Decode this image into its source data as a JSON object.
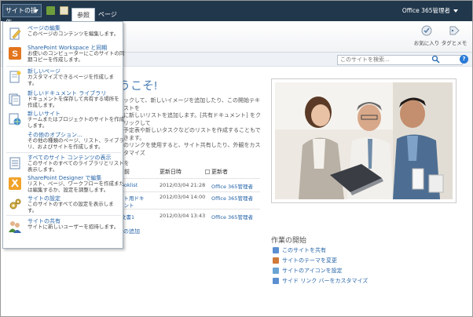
{
  "topbar": {
    "site_actions_label": "サイトの操作",
    "tabs": [
      "参照",
      "ページ"
    ],
    "user_label": "Office 365管理者"
  },
  "ribbon": {
    "favorite_label": "お気に入り",
    "tags_label": "タグとメモ"
  },
  "search": {
    "placeholder": "このサイトを検索..."
  },
  "menu": {
    "items": [
      {
        "title": "ページの編集",
        "desc": [
          "このページのコンテンツを編集します。"
        ],
        "icon": "edit-page-icon"
      },
      {
        "title": "SharePoint Workspace と同期",
        "desc": [
          "お使いのコンピューターにこのサイトの同",
          "期コピーを作成します。"
        ],
        "icon": "workspace-sync-icon"
      },
      {
        "title": "新しいページ",
        "desc": [
          "カスタマイズできるページを作成しま",
          "す。"
        ],
        "icon": "new-page-icon"
      },
      {
        "title": "新しいドキュメント ライブラリ",
        "desc": [
          "ドキュメントを保存して共有する場所を",
          "作成します。"
        ],
        "icon": "new-doc-library-icon"
      },
      {
        "title": "新しいサイト",
        "desc": [
          "チームまたはプロジェクトのサイトを作成",
          "します。"
        ],
        "icon": "new-site-icon"
      },
      {
        "title": "その他のオプション...",
        "desc": [
          "その他の種類のページ、リスト、ライブラ",
          "リ、およびサイトを作成します。"
        ],
        "icon": "more-options-icon"
      },
      {
        "title": "すべてのサイト コンテンツの表示",
        "desc": [
          "このサイトのすべてのライブラリとリストを",
          "表示します。"
        ],
        "icon": "view-all-content-icon"
      },
      {
        "title": "SharePoint Designer で編集",
        "desc": [
          "リスト、ページ、ワークフローを作成また",
          "は編集するか、設定を調整します。"
        ],
        "icon": "designer-edit-icon"
      },
      {
        "title": "サイトの設定",
        "desc": [
          "このサイトのすべての設定を表示しま",
          "す。"
        ],
        "icon": "site-settings-icon"
      },
      {
        "title": "サイトの共有",
        "desc": [
          "サイトに新しいユーザーを招待します。"
        ],
        "icon": "share-site-icon"
      }
    ]
  },
  "main": {
    "welcome": "うこそ!",
    "intro_lines": [
      "ックして、新しいイメージを追加したり、この開始テキストを",
      "に新しいリストを追加します。[共有ドキュメント] をクリックして",
      "予定表や新しいタスクなどのリストを作成することもできます。",
      "のリンクを使用すると、サイト共有したり、外観をカスタマイズ"
    ],
    "table": {
      "headers": [
        "名前",
        "更新日時",
        "更新者"
      ],
      "rows": [
        {
          "name": "ooklist",
          "date": "2012/03/04 21:28",
          "modified_by": "Office 365管理者"
        },
        {
          "name": "スト用ドキ",
          "name2": "メント",
          "date": "2012/03/04 14:00",
          "modified_by": "Office 365管理者"
        },
        {
          "name": "文書1",
          "date": "2012/03/04 13:43",
          "modified_by": "Office 365管理者"
        }
      ],
      "add_label": "の追加"
    }
  },
  "tasks": {
    "title": "作業の開始",
    "items": [
      {
        "label": "このサイトを共有",
        "color": "#5b8fd0"
      },
      {
        "label": "サイトのテーマを変更",
        "color": "#d07a3a"
      },
      {
        "label": "サイトのアイコンを設定",
        "color": "#6aa4d4"
      },
      {
        "label": "サイド リンク バーをカスタマイズ",
        "color": "#5b8fd0"
      }
    ]
  },
  "colors": {
    "topbar": "#21374c",
    "link": "#2664a8",
    "welcome": "#4a7fb5"
  }
}
